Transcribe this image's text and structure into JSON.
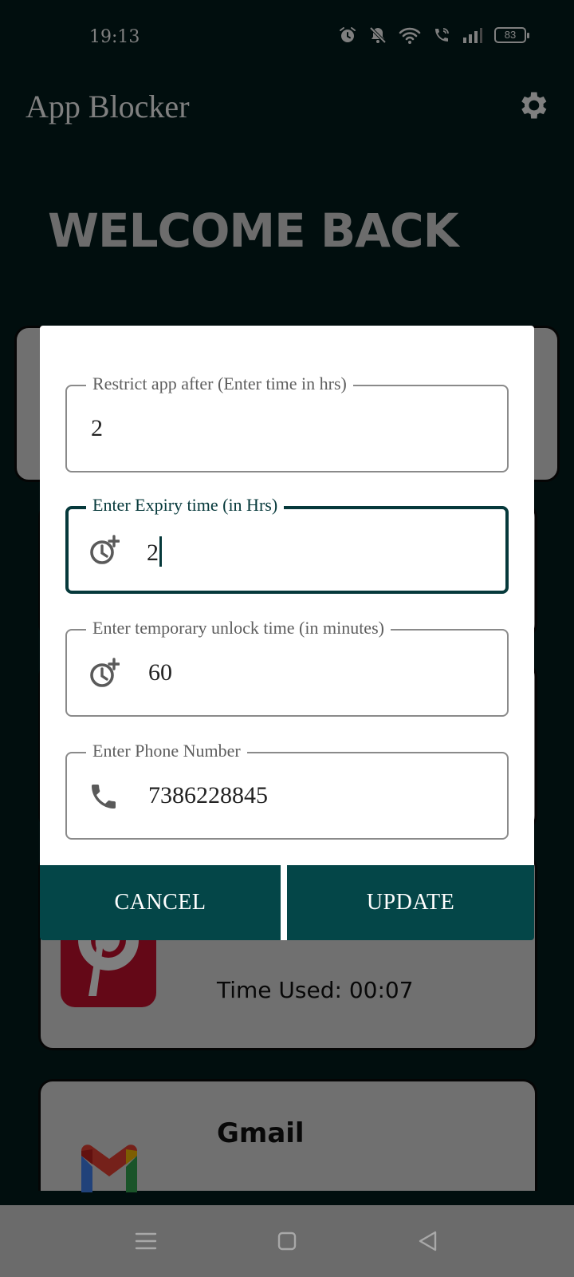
{
  "status_bar": {
    "time": "19:13",
    "battery_level": "83",
    "icons": [
      "alarm-icon",
      "notifications-off-icon",
      "wifi-icon",
      "wifi-calling-icon",
      "cell-signal-icon",
      "battery-icon"
    ]
  },
  "app": {
    "title": "App Blocker",
    "welcome": "WELCOME BACK",
    "settings_icon": "gear-icon",
    "accent_color": "#044648"
  },
  "background_cards": {
    "pinterest_time_used": "Time Used: 00:07",
    "gmail_label": "Gmail"
  },
  "dialog": {
    "fields": [
      {
        "label": "Restrict app after (Enter time in hrs)",
        "value": "2",
        "icon": null
      },
      {
        "label": "Enter Expiry time (in Hrs)",
        "value": "2",
        "icon": "alarm-add-icon",
        "focused": true
      },
      {
        "label": "Enter temporary unlock time (in minutes)",
        "value": "60",
        "icon": "alarm-add-icon"
      },
      {
        "label": "Enter Phone Number",
        "value": "7386228845",
        "icon": "phone-icon"
      }
    ],
    "cancel_label": "CANCEL",
    "update_label": "UPDATE"
  },
  "nav_bar": {
    "icons": [
      "menu-icon",
      "home-icon",
      "back-icon"
    ]
  }
}
